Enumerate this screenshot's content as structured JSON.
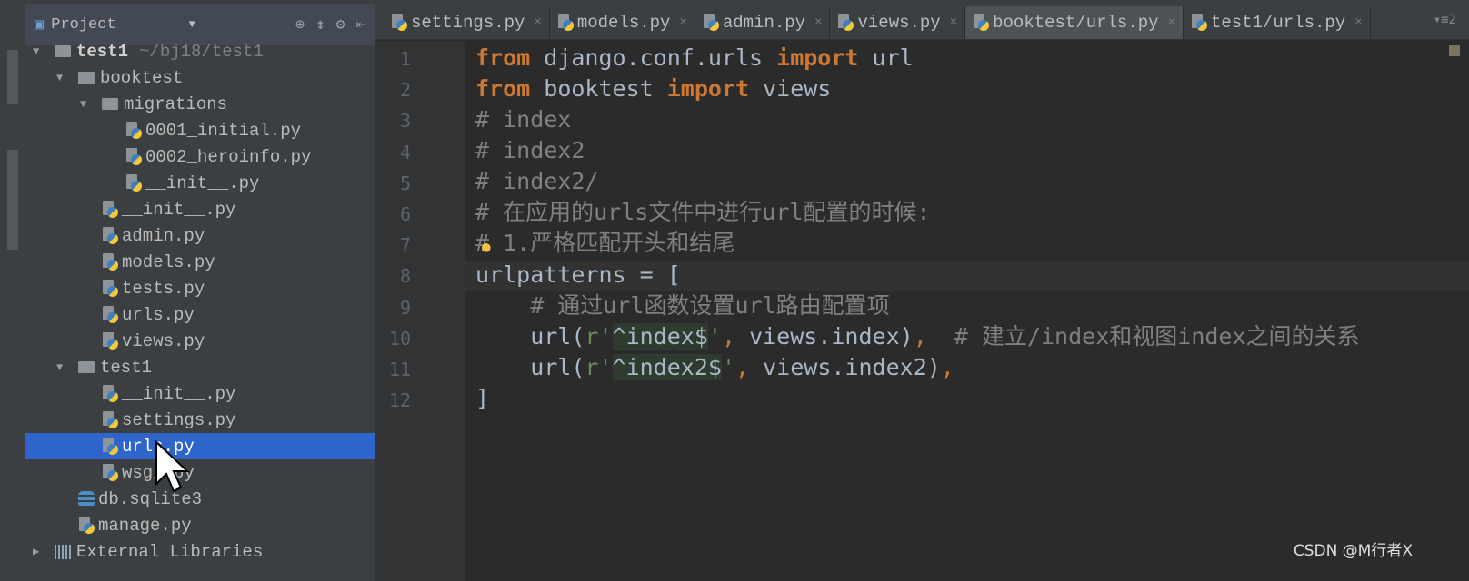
{
  "project_panel": {
    "title": "Project"
  },
  "tree": [
    {
      "label": "test1",
      "hint": "~/bj18/test1",
      "type": "folder",
      "level": 0,
      "expanded": true
    },
    {
      "label": "booktest",
      "type": "folder",
      "level": 1,
      "expanded": true
    },
    {
      "label": "migrations",
      "type": "folder",
      "level": 2,
      "expanded": true
    },
    {
      "label": "0001_initial.py",
      "type": "py",
      "level": 3
    },
    {
      "label": "0002_heroinfo.py",
      "type": "py",
      "level": 3
    },
    {
      "label": "__init__.py",
      "type": "py",
      "level": 3
    },
    {
      "label": "__init__.py",
      "type": "py",
      "level": 2
    },
    {
      "label": "admin.py",
      "type": "py",
      "level": 2
    },
    {
      "label": "models.py",
      "type": "py",
      "level": 2
    },
    {
      "label": "tests.py",
      "type": "py",
      "level": 2
    },
    {
      "label": "urls.py",
      "type": "py",
      "level": 2
    },
    {
      "label": "views.py",
      "type": "py",
      "level": 2
    },
    {
      "label": "test1",
      "type": "folder",
      "level": 1,
      "expanded": true
    },
    {
      "label": "__init__.py",
      "type": "py",
      "level": 2
    },
    {
      "label": "settings.py",
      "type": "py",
      "level": 2
    },
    {
      "label": "urls.py",
      "type": "py",
      "level": 2,
      "selected": true
    },
    {
      "label": "wsgi.py",
      "type": "py",
      "level": 2
    },
    {
      "label": "db.sqlite3",
      "type": "db",
      "level": 1
    },
    {
      "label": "manage.py",
      "type": "py",
      "level": 1
    },
    {
      "label": "External Libraries",
      "type": "libs",
      "level": 0,
      "expanded": false
    }
  ],
  "tabs": [
    {
      "label": "settings.py"
    },
    {
      "label": "models.py"
    },
    {
      "label": "admin.py"
    },
    {
      "label": "views.py"
    },
    {
      "label": "booktest/urls.py",
      "active": true
    },
    {
      "label": "test1/urls.py"
    }
  ],
  "tab_menu": "▾≡2",
  "code": {
    "l1": {
      "a": "from",
      "b": " django.conf.urls ",
      "c": "import",
      "d": " url"
    },
    "l2": {
      "a": "from",
      "b": " booktest ",
      "c": "import",
      "d": " views"
    },
    "l3": "# index",
    "l4": "# index2",
    "l5": "# index2/",
    "l6": "# 在应用的urls文件中进行url配置的时候:",
    "l7": "# 1.严格匹配开头和结尾",
    "l8": "urlpatterns = [",
    "l9": "    # 通过url函数设置url路由配置项",
    "l10": {
      "a": "    url(",
      "b": "r'",
      "c": "^index$",
      "d": "'",
      ",": ",",
      "e": " views.index)",
      "f": ",",
      "g": "  # 建立/index和视图index之间的关系"
    },
    "l11": {
      "a": "    url(",
      "b": "r'",
      "c": "^index2$",
      "d": "'",
      ",": ",",
      "e": " views.index2)",
      "f": ","
    },
    "l12": "]"
  },
  "watermark": "CSDN @M行者X",
  "colors": {
    "keyword": "#cc7832",
    "comment": "#808080",
    "string": "#6a8759",
    "selection": "#2f65ca"
  }
}
